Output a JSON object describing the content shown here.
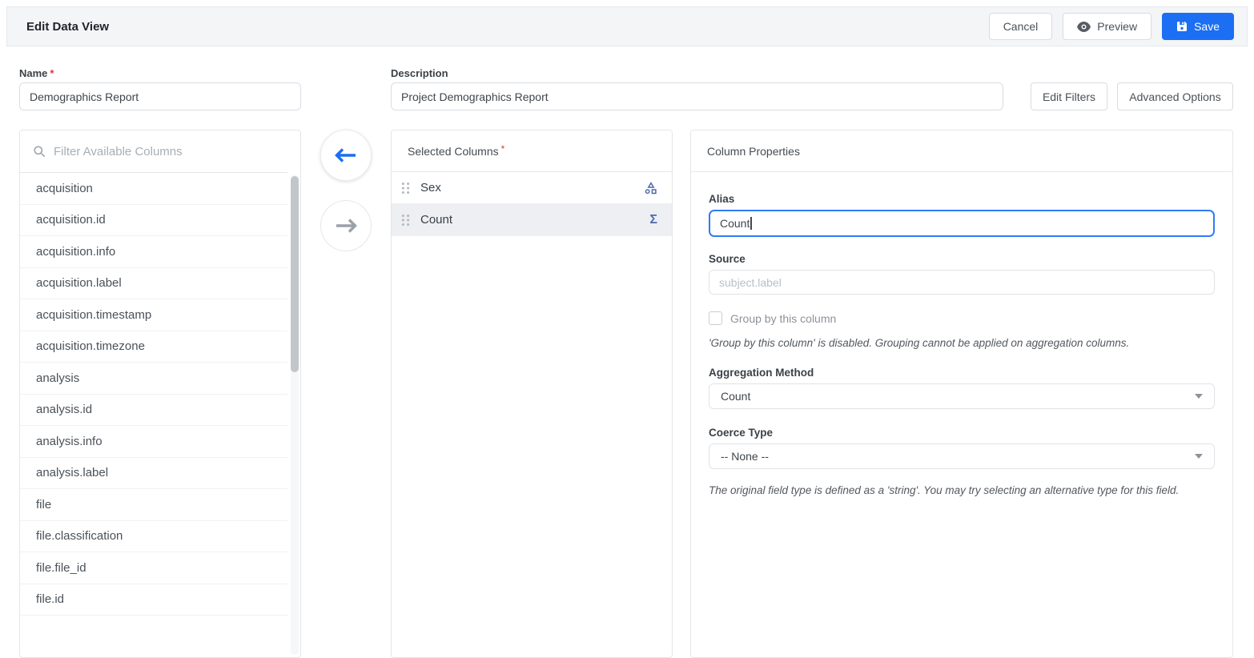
{
  "colors": {
    "accent_blue": "#1c6ef2",
    "icon_blue": "#4a6aae",
    "selected_row_bg": "#edeff2",
    "required_red": "#d93a36"
  },
  "topbar": {
    "title": "Edit Data View",
    "cancel_label": "Cancel",
    "preview_label": "Preview",
    "save_label": "Save"
  },
  "form": {
    "name_label": "Name",
    "name_required_mark": "*",
    "name_value": "Demographics Report",
    "description_label": "Description",
    "description_value": "Project Demographics Report",
    "edit_filters_label": "Edit Filters",
    "advanced_options_label": "Advanced Options"
  },
  "available_columns": {
    "filter_placeholder": "Filter Available Columns",
    "items": [
      "acquisition",
      "acquisition.id",
      "acquisition.info",
      "acquisition.label",
      "acquisition.timestamp",
      "acquisition.timezone",
      "analysis",
      "analysis.id",
      "analysis.info",
      "analysis.label",
      "file",
      "file.classification",
      "file.file_id",
      "file.id"
    ]
  },
  "selected_columns": {
    "title": "Selected Columns",
    "required_mark": "*",
    "items": [
      {
        "label": "Sex",
        "icon": "group-by-icon",
        "selected": false
      },
      {
        "label": "Count",
        "icon": "sigma-icon",
        "selected": true
      }
    ]
  },
  "column_properties": {
    "title": "Column Properties",
    "alias_label": "Alias",
    "alias_value": "Count",
    "source_label": "Source",
    "source_value": "subject.label",
    "group_by_label": "Group by this column",
    "group_by_checked": false,
    "group_by_note": "'Group by this column' is disabled. Grouping cannot be applied on aggregation columns.",
    "aggregation_label": "Aggregation Method",
    "aggregation_value": "Count",
    "coerce_label": "Coerce Type",
    "coerce_value": "-- None --",
    "coerce_note": "The original field type is defined as a 'string'. You may try selecting an alternative type for this field."
  }
}
